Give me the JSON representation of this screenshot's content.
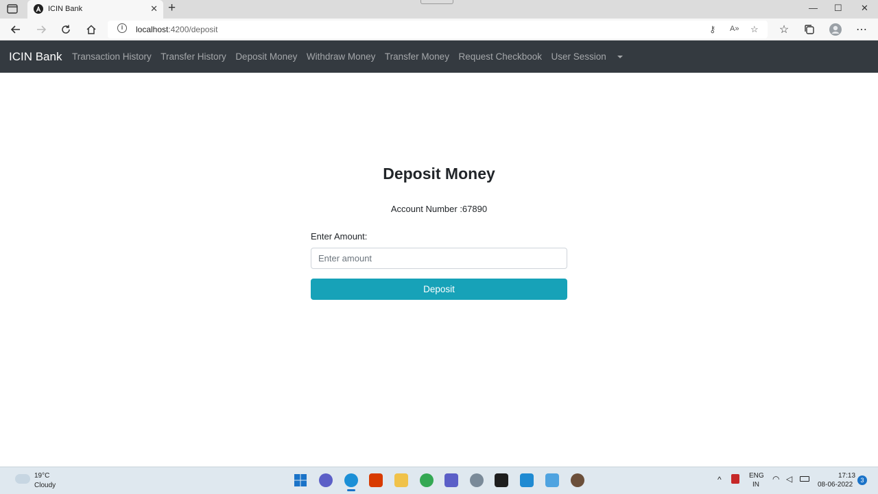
{
  "browser": {
    "tab_title": "ICIN Bank",
    "new_tab_symbol": "+",
    "close_symbol": "✕",
    "url_host": "localhost",
    "url_path": ":4200/deposit",
    "window_controls": {
      "minimize": "—",
      "maximize": "☐",
      "close": "✕"
    }
  },
  "navbar": {
    "brand": "ICIN Bank",
    "links": [
      "Transaction History",
      "Transfer History",
      "Deposit Money",
      "Withdraw Money",
      "Transfer Money",
      "Request Checkbook",
      "User Session"
    ]
  },
  "main": {
    "heading": "Deposit Money",
    "account_text": "Account Number :67890",
    "amount_label": "Enter Amount:",
    "amount_placeholder": "Enter amount",
    "amount_value": "",
    "deposit_button": "Deposit"
  },
  "taskbar": {
    "weather_temp": "19°C",
    "weather_condition": "Cloudy",
    "language": "ENG",
    "region": "IN",
    "time": "17:13",
    "date": "08-06-2022",
    "notifications": "3"
  },
  "colors": {
    "navbar_bg": "#343a40",
    "button_bg": "#17a2b8"
  }
}
